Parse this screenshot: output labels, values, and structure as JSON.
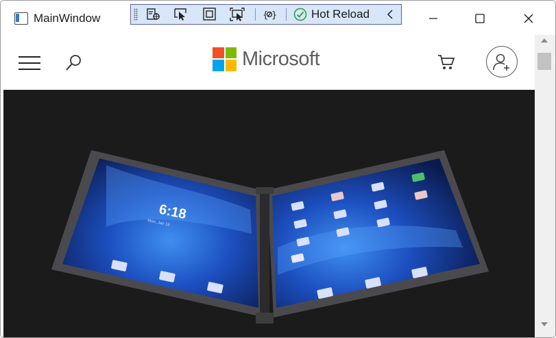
{
  "window": {
    "title": "MainWindow"
  },
  "toolbar": {
    "hot_reload_label": "Hot Reload",
    "hot_reload_status": "success"
  },
  "site": {
    "brand": "Microsoft",
    "logo_colors": [
      "#f25022",
      "#7fba00",
      "#00a4ef",
      "#ffb900"
    ]
  },
  "hero": {
    "device": {
      "clock": "6:18",
      "date": "Mon, Jan 18"
    }
  },
  "colors": {
    "toolbar_bg": "#d8e6f9",
    "toolbar_border": "#5b5f9e",
    "hero_bg": "#1b1b1b",
    "check_green": "#2e9e3a"
  }
}
